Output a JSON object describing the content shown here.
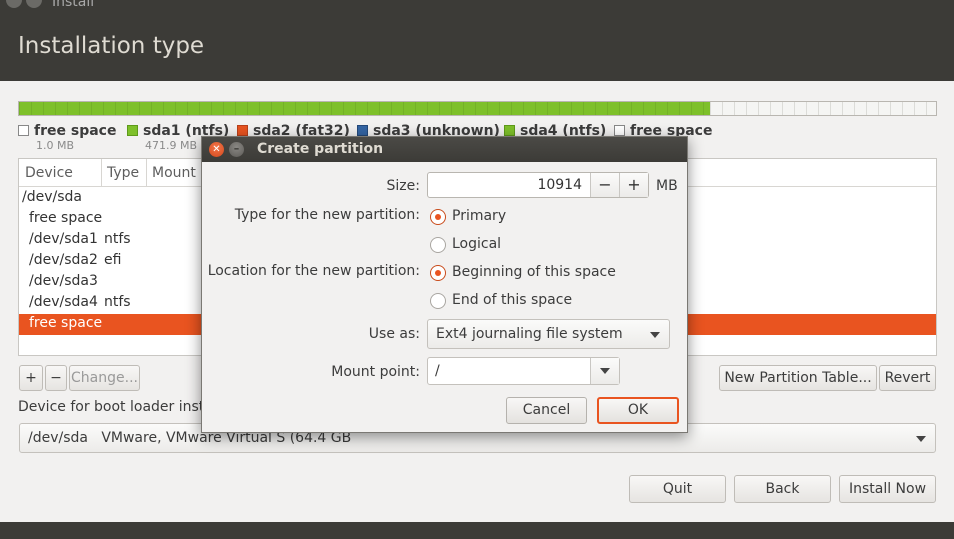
{
  "window": {
    "title": "Install",
    "page_title": "Installation type"
  },
  "partition_bar": {
    "used_fraction": 0.753,
    "used_color": "#7ec02a"
  },
  "legend": [
    {
      "name": "free space",
      "size": "1.0 MB",
      "color": "#ffffff"
    },
    {
      "name": "sda1 (ntfs)",
      "size": "471.9 MB",
      "color": "#7ec02a"
    },
    {
      "name": "sda2 (fat32)",
      "size": "",
      "color": "#e95420"
    },
    {
      "name": "sda3 (unknown)",
      "size": "",
      "color": "#3465a4"
    },
    {
      "name": "sda4 (ntfs)",
      "size": "",
      "color": "#7ec02a"
    },
    {
      "name": "free space",
      "size": "",
      "color": "#ffffff"
    }
  ],
  "table": {
    "columns": [
      "Device",
      "Type",
      "Mount"
    ],
    "rows": [
      {
        "device": "/dev/sda",
        "type": ""
      },
      {
        "device": "free space",
        "type": ""
      },
      {
        "device": "/dev/sda1",
        "type": "ntfs"
      },
      {
        "device": "/dev/sda2",
        "type": "efi"
      },
      {
        "device": "/dev/sda3",
        "type": ""
      },
      {
        "device": "/dev/sda4",
        "type": "ntfs"
      },
      {
        "device": "free space",
        "type": "",
        "selected": true
      }
    ]
  },
  "table_buttons": {
    "add": "+",
    "remove": "−",
    "change": "Change...",
    "new_table": "New Partition Table...",
    "revert": "Revert"
  },
  "boot_loader": {
    "label": "Device for boot loader insta",
    "value": "/dev/sda   VMware, VMware Virtual S (64.4 GB"
  },
  "footer_buttons": {
    "quit": "Quit",
    "back": "Back",
    "install": "Install Now"
  },
  "dialog": {
    "title": "Create partition",
    "size_label": "Size:",
    "size_value": "10914",
    "size_unit": "MB",
    "minus": "−",
    "plus": "+",
    "type_label": "Type for the new partition:",
    "type_options": [
      "Primary",
      "Logical"
    ],
    "type_selected": "Primary",
    "location_label": "Location for the new partition:",
    "location_options": [
      "Beginning of this space",
      "End of this space"
    ],
    "location_selected": "Beginning of this space",
    "use_as_label": "Use as:",
    "use_as_value": "Ext4 journaling file system",
    "mount_label": "Mount point:",
    "mount_value": "/",
    "cancel": "Cancel",
    "ok": "OK"
  }
}
